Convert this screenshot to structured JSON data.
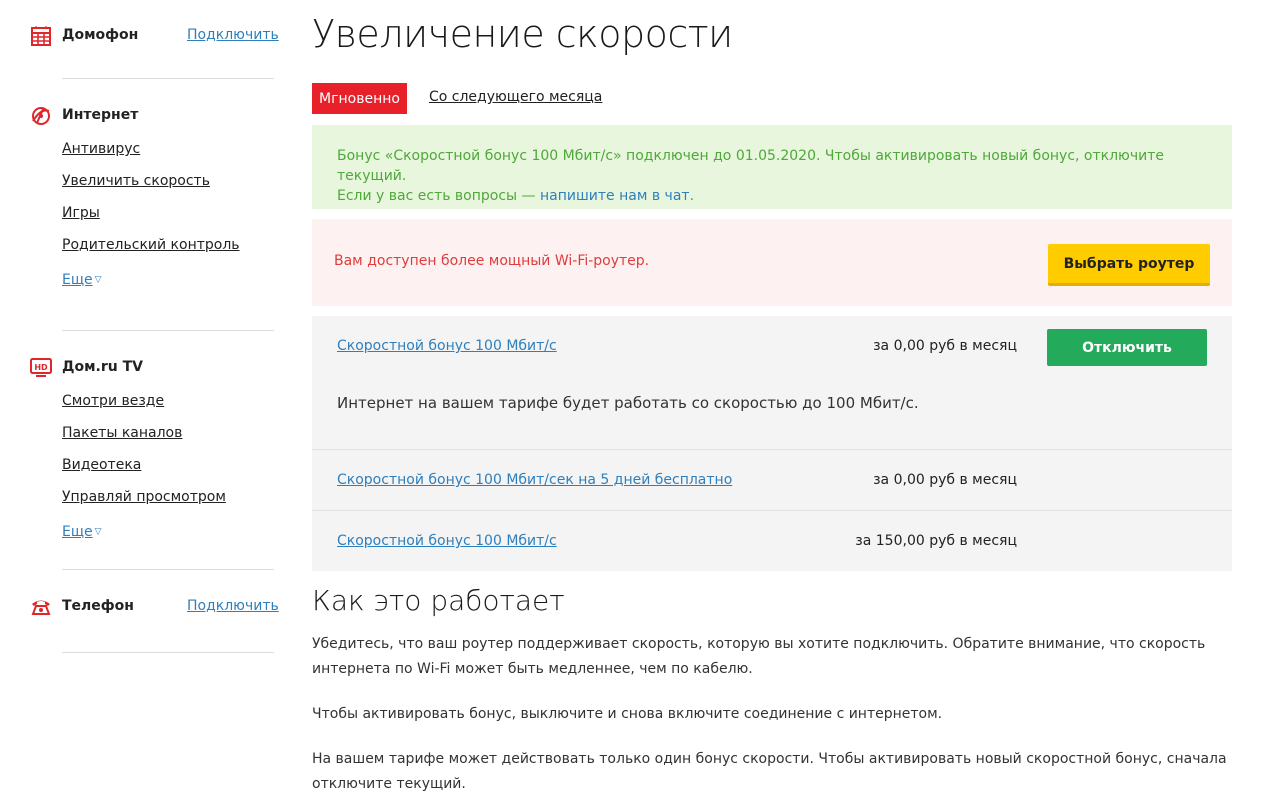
{
  "sidebar": {
    "domofon": {
      "title": "Домофон",
      "link": "Подключить"
    },
    "internet": {
      "title": "Интернет",
      "items": [
        "Антивирус",
        "Увеличить скорость",
        "Игры",
        "Родительский контроль"
      ],
      "more": "Еще"
    },
    "tv": {
      "title": "Дом.ru TV",
      "items": [
        "Смотри везде",
        "Пакеты каналов",
        "Видеотека",
        "Управляй просмотром"
      ],
      "more": "Еще"
    },
    "phone": {
      "title": "Телефон",
      "link": "Подключить"
    }
  },
  "main": {
    "title": "Увеличение скорости",
    "tabs": {
      "active": "Мгновенно",
      "other": "Со следующего месяца"
    },
    "green_notice": {
      "line1": "Бонус «Скоростной бонус 100 Мбит/с» подключен до 01.05.2020. Чтобы активировать новый бонус, отключите текущий.",
      "line2_prefix": "Если у вас есть вопросы — ",
      "line2_link": "напишите нам в чат",
      "line2_suffix": "."
    },
    "red_notice": {
      "text": "Вам доступен более мощный Wi-Fi-роутер.",
      "button": "Выбрать роутер"
    },
    "offers": [
      {
        "name": "Скоростной бонус 100 Мбит/с",
        "price": "за 0,00 руб в месяц",
        "button": "Отключить",
        "description": "Интернет на вашем тарифе будет работать со скоростью до 100 Мбит/с."
      },
      {
        "name": "Скоростной бонус 100 Мбит/сек на 5 дней бесплатно",
        "price": "за 0,00 руб в месяц"
      },
      {
        "name": "Скоростной бонус 100 Мбит/с",
        "price": "за 150,00 руб в месяц"
      }
    ],
    "how": {
      "title": "Как это работает",
      "paragraphs": [
        "Убедитесь, что ваш роутер поддерживает скорость, которую вы хотите подключить. Обратите внимание, что скорость интернета по Wi-Fi может быть медленнее, чем по кабелю.",
        "Чтобы активировать бонус, выключите и снова включите соединение с интернетом.",
        "На вашем тарифе может действовать только один бонус скорости. Чтобы активировать новый скоростной бонус, сначала отключите текущий."
      ]
    }
  },
  "icons": {
    "domofon": "intercom-grid-icon",
    "internet": "internet-globe-icon",
    "tv": "hd-tv-icon",
    "phone": "telephone-icon",
    "more": "chevron-down-icon"
  },
  "colors": {
    "brand_red": "#e8202a",
    "link_blue": "#2f7fbd",
    "success_green": "#24aa5b",
    "notice_green_text": "#4fa83a",
    "notice_green_bg": "#e8f6de",
    "notice_red_text": "#e03c3c",
    "notice_red_bg": "#fdf1f1",
    "button_yellow": "#ffcc00",
    "offer_bg": "#f4f4f4"
  }
}
